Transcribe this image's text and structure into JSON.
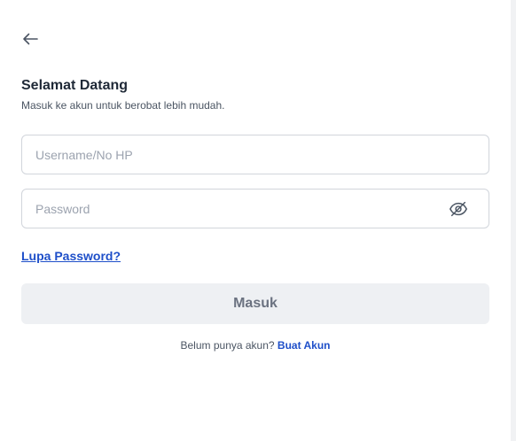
{
  "header": {
    "back_icon": "arrow-left-icon",
    "title": "Selamat Datang",
    "subtitle": "Masuk ke akun untuk berobat lebih mudah."
  },
  "form": {
    "username": {
      "value": "",
      "placeholder": "Username/No HP"
    },
    "password": {
      "value": "",
      "placeholder": "Password",
      "toggle_icon": "eye-off-icon"
    },
    "forgot_label": "Lupa Password?",
    "submit_label": "Masuk"
  },
  "footer": {
    "prompt": "Belum punya akun?",
    "signup_label": "Buat Akun"
  },
  "colors": {
    "accent": "#1e4fc9",
    "button_bg": "#eef0f3",
    "button_text": "#6b7280",
    "border": "#d1d5db"
  }
}
